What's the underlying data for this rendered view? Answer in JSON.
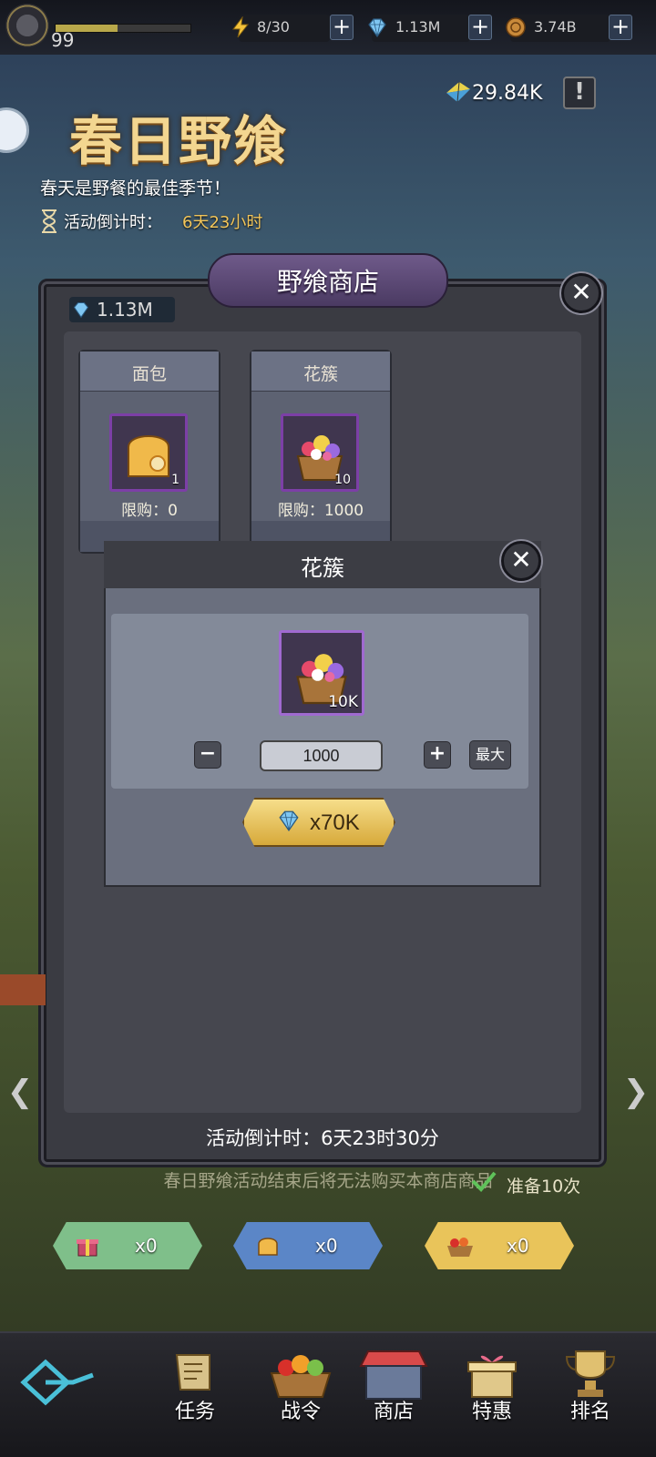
{
  "top_bar": {
    "level": "99",
    "xp_fraction": 0.46,
    "energy": "8/30",
    "gems": "1.13M",
    "coins": "3.74B",
    "plus_label": "+"
  },
  "event": {
    "title": "春日野飨",
    "subtitle": "春天是野餐的最佳季节！",
    "countdown_label": "活动倒计时：",
    "countdown_value": "6天23小时",
    "kite_points": "29.84K",
    "info_label": "!"
  },
  "shop": {
    "title": "野飨商店",
    "close_label": "✕",
    "currency": "1.13M",
    "cards": [
      {
        "name": "面包",
        "qty": "1",
        "limit": "限购：0"
      },
      {
        "name": "花簇",
        "qty": "10",
        "limit": "限购：1000"
      }
    ],
    "countdown": "活动倒计时：6天23时30分",
    "note": "春日野飨活动结束后将无法购买本商店商品"
  },
  "prep": {
    "text": "准备10次"
  },
  "counters": [
    {
      "value": "x0",
      "color": "#7fbf8a"
    },
    {
      "value": "x0",
      "color": "#5b86c7"
    },
    {
      "value": "x0",
      "color": "#e9c45a"
    }
  ],
  "side": {
    "left_arrow": "❮",
    "right_arrow": "❯"
  },
  "nav": {
    "items": [
      {
        "label": "任务",
        "icon": "scroll-icon"
      },
      {
        "label": "战令",
        "icon": "fruit-basket-icon"
      },
      {
        "label": "商店",
        "icon": "shop-stall-icon"
      },
      {
        "label": "特惠",
        "icon": "gift-icon"
      },
      {
        "label": "排名",
        "icon": "trophy-icon"
      }
    ]
  },
  "dialog": {
    "title": "花簇",
    "item_qty": "10K",
    "quantity": "1000",
    "minus_label": "−",
    "plus_label": "+",
    "max_label": "最大",
    "price": "x70K"
  }
}
